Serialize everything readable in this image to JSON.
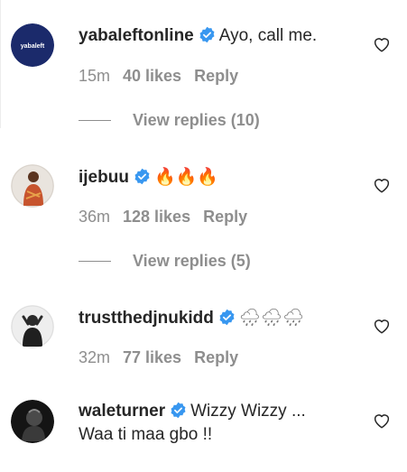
{
  "comments": [
    {
      "username": "yabaleftonline",
      "text": "Ayo, call me.",
      "time": "15m",
      "likes": "40 likes",
      "reply": "Reply",
      "view_replies": "View replies (10)",
      "avatar_text": "yabaleft"
    },
    {
      "username": "ijebuu",
      "text": "🔥🔥🔥",
      "time": "36m",
      "likes": "128 likes",
      "reply": "Reply",
      "view_replies": "View replies (5)"
    },
    {
      "username": "trustthedjnukidd",
      "text": "🌧🌧🌧",
      "time": "32m",
      "likes": "77 likes",
      "reply": "Reply"
    },
    {
      "username": "waleturner",
      "text": "Wizzy Wizzy ...",
      "text_line2": "Waa ti maa gbo !!"
    }
  ],
  "colors": {
    "verified": "#3897f0",
    "meta": "#8e8e8e",
    "text": "#262626"
  },
  "icons": [
    "verified-badge-icon",
    "heart-icon"
  ]
}
